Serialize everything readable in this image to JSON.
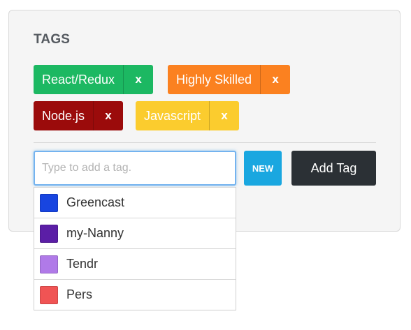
{
  "panel": {
    "title": "TAGS"
  },
  "tags": [
    {
      "label": "React/Redux",
      "remove": "x",
      "color": "#1cb862"
    },
    {
      "label": "Highly Skilled",
      "remove": "x",
      "color": "#fb8120"
    },
    {
      "label": "Node.js",
      "remove": "x",
      "color": "#9b0b0b"
    },
    {
      "label": "Javascript",
      "remove": "x",
      "color": "#fbcc2e"
    }
  ],
  "input": {
    "placeholder": "Type to add a tag.",
    "value": ""
  },
  "buttons": {
    "new_label": "NEW",
    "new_color": "#1aa7e0",
    "add_label": "Add Tag",
    "add_color": "#2b3035"
  },
  "suggestions": [
    {
      "label": "Greencast",
      "color": "#1845e0"
    },
    {
      "label": "my-Nanny",
      "color": "#5b1ea6"
    },
    {
      "label": "Tendr",
      "color": "#b07ae8"
    },
    {
      "label": "Pers",
      "color": "#f05454"
    }
  ]
}
